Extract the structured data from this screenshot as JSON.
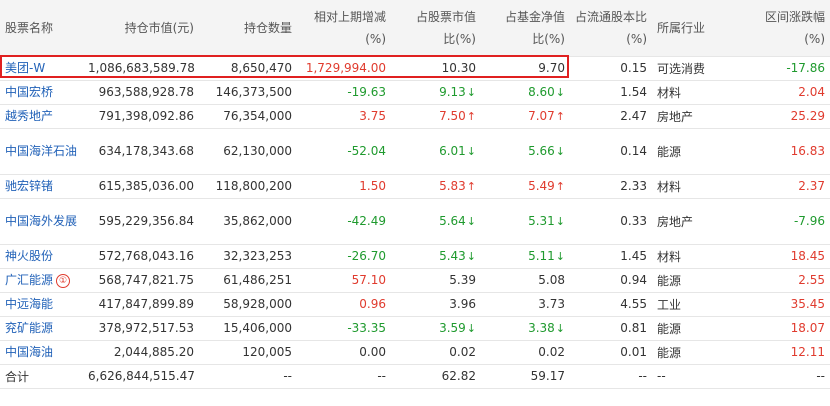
{
  "headers": {
    "name": "股票名称",
    "market_value": "持仓市值(元)",
    "quantity": "持仓数量",
    "change_l1": "相对上期增减",
    "change_l2": "(%)",
    "stock_ratio_l1": "占股票市值",
    "stock_ratio_l2": "比(%)",
    "nav_ratio_l1": "占基金净值",
    "nav_ratio_l2": "比(%)",
    "float_l1": "占流通股本比",
    "float_l2": "(%)",
    "industry": "所属行业",
    "interval_l1": "区间涨跌幅",
    "interval_l2": "(%)"
  },
  "rows": [
    {
      "name": "美团-W",
      "market_value": "1,086,683,589.78",
      "quantity": "8,650,470",
      "change": "1,729,994.00",
      "change_dir": "up",
      "stock_ratio": "10.30",
      "stock_arrow": "",
      "nav_ratio": "9.70",
      "nav_arrow": "",
      "float_ratio": "0.15",
      "industry": "可选消费",
      "interval": "-17.86",
      "interval_dir": "down"
    },
    {
      "name": "中国宏桥",
      "market_value": "963,588,928.78",
      "quantity": "146,373,500",
      "change": "-19.63",
      "change_dir": "down",
      "stock_ratio": "9.13",
      "stock_arrow": "↓",
      "nav_ratio": "8.60",
      "nav_arrow": "↓",
      "float_ratio": "1.54",
      "industry": "材料",
      "interval": "2.04",
      "interval_dir": "up"
    },
    {
      "name": "越秀地产",
      "market_value": "791,398,092.86",
      "quantity": "76,354,000",
      "change": "3.75",
      "change_dir": "up",
      "stock_ratio": "7.50",
      "stock_arrow": "↑",
      "nav_ratio": "7.07",
      "nav_arrow": "↑",
      "float_ratio": "2.47",
      "industry": "房地产",
      "interval": "25.29",
      "interval_dir": "up"
    },
    {
      "name": "中国海洋石油",
      "market_value": "634,178,343.68",
      "quantity": "62,130,000",
      "change": "-52.04",
      "change_dir": "down",
      "stock_ratio": "6.01",
      "stock_arrow": "↓",
      "nav_ratio": "5.66",
      "nav_arrow": "↓",
      "float_ratio": "0.14",
      "industry": "能源",
      "interval": "16.83",
      "interval_dir": "up"
    },
    {
      "name": "驰宏锌锗",
      "market_value": "615,385,036.00",
      "quantity": "118,800,200",
      "change": "1.50",
      "change_dir": "up",
      "stock_ratio": "5.83",
      "stock_arrow": "↑",
      "nav_ratio": "5.49",
      "nav_arrow": "↑",
      "float_ratio": "2.33",
      "industry": "材料",
      "interval": "2.37",
      "interval_dir": "up"
    },
    {
      "name": "中国海外发展",
      "market_value": "595,229,356.84",
      "quantity": "35,862,000",
      "change": "-42.49",
      "change_dir": "down",
      "stock_ratio": "5.64",
      "stock_arrow": "↓",
      "nav_ratio": "5.31",
      "nav_arrow": "↓",
      "float_ratio": "0.33",
      "industry": "房地产",
      "interval": "-7.96",
      "interval_dir": "down"
    },
    {
      "name": "神火股份",
      "market_value": "572,768,043.16",
      "quantity": "32,323,253",
      "change": "-26.70",
      "change_dir": "down",
      "stock_ratio": "5.43",
      "stock_arrow": "↓",
      "nav_ratio": "5.11",
      "nav_arrow": "↓",
      "float_ratio": "1.45",
      "industry": "材料",
      "interval": "18.45",
      "interval_dir": "up"
    },
    {
      "name": "广汇能源",
      "badge": "①",
      "market_value": "568,747,821.75",
      "quantity": "61,486,251",
      "change": "57.10",
      "change_dir": "up",
      "stock_ratio": "5.39",
      "stock_arrow": "",
      "nav_ratio": "5.08",
      "nav_arrow": "",
      "float_ratio": "0.94",
      "industry": "能源",
      "interval": "2.55",
      "interval_dir": "up"
    },
    {
      "name": "中远海能",
      "market_value": "417,847,899.89",
      "quantity": "58,928,000",
      "change": "0.96",
      "change_dir": "up",
      "stock_ratio": "3.96",
      "stock_arrow": "",
      "nav_ratio": "3.73",
      "nav_arrow": "",
      "float_ratio": "4.55",
      "industry": "工业",
      "interval": "35.45",
      "interval_dir": "up"
    },
    {
      "name": "兖矿能源",
      "market_value": "378,972,517.53",
      "quantity": "15,406,000",
      "change": "-33.35",
      "change_dir": "down",
      "stock_ratio": "3.59",
      "stock_arrow": "↓",
      "nav_ratio": "3.38",
      "nav_arrow": "↓",
      "float_ratio": "0.81",
      "industry": "能源",
      "interval": "18.07",
      "interval_dir": "up"
    },
    {
      "name": "中国海油",
      "market_value": "2,044,885.20",
      "quantity": "120,005",
      "change": "0.00",
      "change_dir": "flat",
      "stock_ratio": "0.02",
      "stock_arrow": "",
      "nav_ratio": "0.02",
      "nav_arrow": "",
      "float_ratio": "0.01",
      "industry": "能源",
      "interval": "12.11",
      "interval_dir": "up"
    }
  ],
  "total": {
    "label": "合计",
    "market_value": "6,626,844,515.47",
    "quantity": "--",
    "change": "--",
    "stock_ratio": "62.82",
    "nav_ratio": "59.17",
    "float_ratio": "--",
    "industry": "--",
    "interval": "--"
  },
  "colors": {
    "up": "#e03b2e",
    "down": "#1f9a2e",
    "link": "#2262b8",
    "highlight_border": "#e02020"
  }
}
